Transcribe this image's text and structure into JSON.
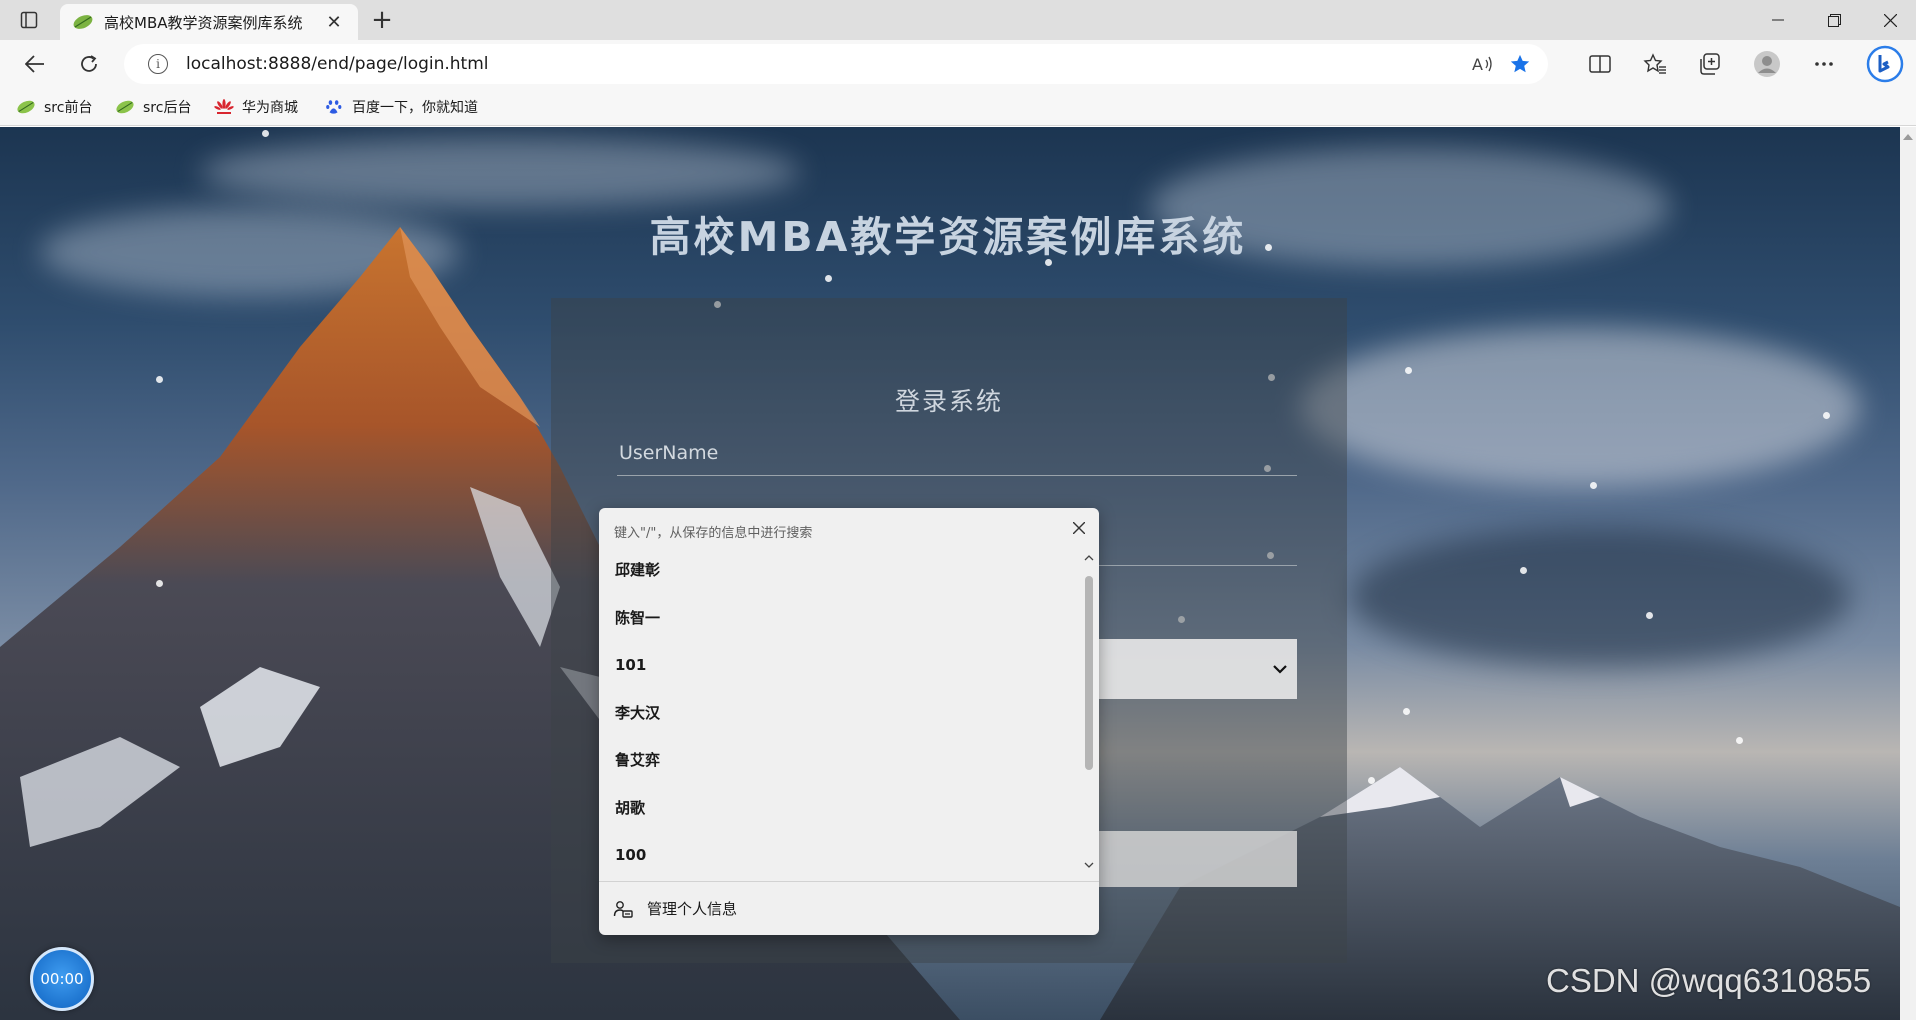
{
  "browser": {
    "tab": {
      "title": "高校MBA教学资源案例库系统"
    },
    "address": {
      "url": "localhost:8888/end/page/login.html"
    },
    "bookmarks": [
      {
        "label": "src前台",
        "icon": "leaf-icon"
      },
      {
        "label": "src后台",
        "icon": "leaf-icon"
      },
      {
        "label": "华为商城",
        "icon": "huawei-icon"
      },
      {
        "label": "百度一下，你就知道",
        "icon": "baidu-paw-icon"
      }
    ]
  },
  "page": {
    "title": "高校MBA教学资源案例库系统",
    "login": {
      "heading": "登录系统",
      "username_placeholder": "UserName"
    }
  },
  "autofill": {
    "search_hint": "键入\"/\"，从保存的信息中进行搜索",
    "items": [
      "邱建彰",
      "陈智一",
      "101",
      "李大汉",
      "鲁艾弈",
      "胡歌",
      "100"
    ],
    "footer_label": "管理个人信息"
  },
  "timer": {
    "value": "00:00"
  },
  "watermark": "CSDN @wqq6310855",
  "colors": {
    "favorite_star": "#1a73e8",
    "timer_blue": "#1d74cf"
  }
}
